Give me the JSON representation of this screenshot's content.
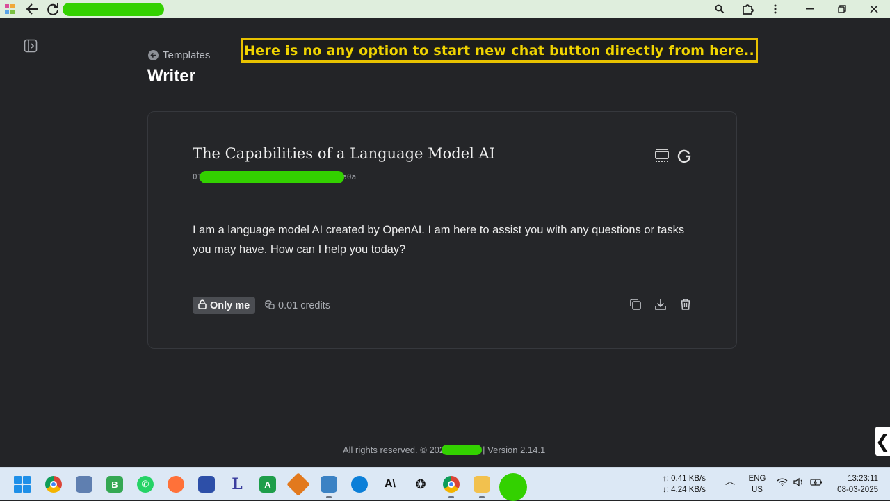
{
  "browser": {
    "back_icon": "arrow-left-icon",
    "reload_icon": "reload-icon",
    "zoom_icon": "zoom-icon",
    "extensions_icon": "puzzle-icon",
    "menu_icon": "more-vertical-icon"
  },
  "header": {
    "back_label": "Templates",
    "title": "Writer"
  },
  "annotation": {
    "text": "Here is no any option to start new chat button directly from here.."
  },
  "document": {
    "title": "The Capabilities of a Language Model AI",
    "id_prefix": "01",
    "id_suffix": "a0a",
    "body": "I am a language model AI created by OpenAI. I am here to assist you with any questions or tasks you may have. How can I help you today?",
    "privacy_label": "Only me",
    "credits_label": "0.01 credits"
  },
  "footer": {
    "rights_text": "All rights reserved. © 202",
    "version_text": "| Version 2.14.1"
  },
  "tray": {
    "upload_speed": "↑: 0.41 KB/s",
    "download_speed": "↓: 4.24 KB/s",
    "lang_top": "ENG",
    "lang_bottom": "US",
    "time": "13:23:11",
    "date": "08-03-2025"
  },
  "colors": {
    "background": "#232427",
    "annotation_border": "#e8c200",
    "redaction": "#33d100"
  }
}
